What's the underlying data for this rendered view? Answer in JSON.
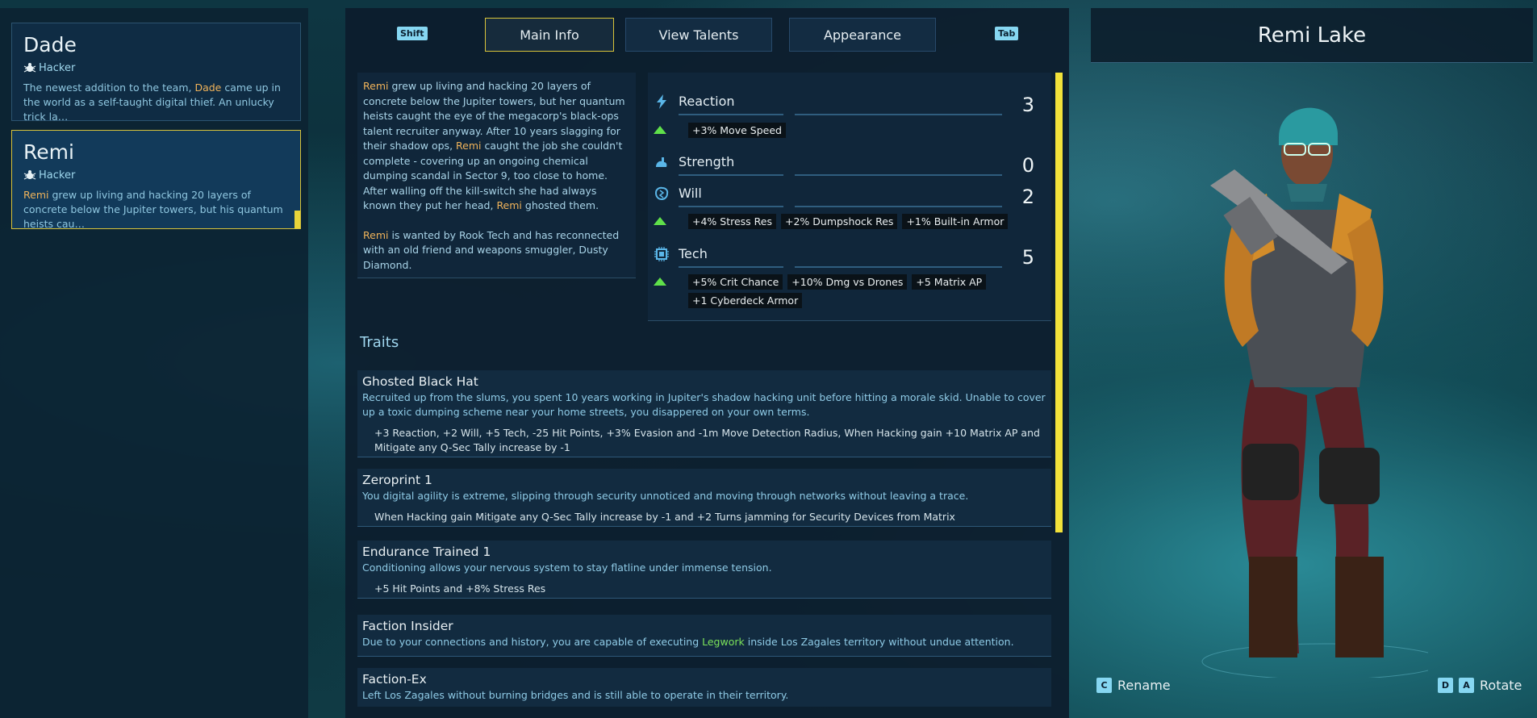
{
  "tabs": {
    "left_key": "Shift",
    "right_key": "Tab",
    "items": [
      "Main Info",
      "View Talents",
      "Appearance"
    ],
    "active": "Main Info"
  },
  "roster": [
    {
      "name": "Dade",
      "class": "Hacker",
      "desc_pre": "The newest addition to the team, ",
      "desc_hl": "Dade",
      "desc_post": " came up in the world as a self-taught digital thief. An unlucky trick la…"
    },
    {
      "name": "Remi",
      "class": "Hacker",
      "desc_hl": "Remi",
      "desc_post": " grew up living and hacking 20 layers of concrete below the Jupiter towers, but his quantum heists cau…"
    }
  ],
  "bio": {
    "p1_a": "Remi",
    "p1_b": " grew up living and hacking 20 layers of concrete below the Jupiter towers, but her quantum heists caught the eye of the megacorp's black-ops talent recruiter anyway. After 10 years slagging for their shadow ops, ",
    "p1_c": "Remi",
    "p1_d": " caught the job she couldn't complete - covering up an ongoing chemical dumping scandal in Sector 9, too close to home. After walling off the kill-switch she had always known they put her head, ",
    "p1_e": "Remi",
    "p1_f": " ghosted them.",
    "p2_a": "Remi",
    "p2_b": " is wanted by Rook Tech and has reconnected with an old friend and weapons smuggler, Dusty Diamond."
  },
  "stats": [
    {
      "name": "Reaction",
      "value": "3",
      "icon": "lightning-icon",
      "bonuses": [
        "+3% Move Speed"
      ]
    },
    {
      "name": "Strength",
      "value": "0",
      "icon": "arm-icon",
      "bonuses": []
    },
    {
      "name": "Will",
      "value": "2",
      "icon": "brain-icon",
      "bonuses": [
        "+4% Stress Res",
        "+2% Dumpshock Res",
        "+1% Built-in Armor"
      ]
    },
    {
      "name": "Tech",
      "value": "5",
      "icon": "chip-icon",
      "bonuses": [
        "+5% Crit Chance",
        "+10% Dmg vs Drones",
        "+5 Matrix AP",
        "+1 Cyberdeck Armor"
      ]
    }
  ],
  "traits_title": "Traits",
  "traits": [
    {
      "name": "Ghosted Black Hat",
      "desc": "Recruited up from the slums, you spent 10 years working in Jupiter's shadow hacking unit before hitting a morale skid. Unable to cover up a toxic dumping scheme near your home streets, you disappered on your own terms.",
      "effect": "+3 Reaction, +2 Will, +5 Tech, -25 Hit Points, +3% Evasion and -1m Move Detection Radius, When Hacking gain +10 Matrix AP and Mitigate any Q-Sec Tally increase by -1"
    },
    {
      "name": "Zeroprint 1",
      "desc": "You digital agility is extreme, slipping through security unnoticed and moving through networks without leaving a trace.",
      "effect": "When Hacking gain Mitigate any Q-Sec Tally increase by -1 and +2 Turns jamming for Security Devices from Matrix"
    },
    {
      "name": "Endurance Trained 1",
      "desc": "Conditioning allows your nervous system to stay flatline under immense tension.",
      "effect": "+5 Hit Points and +8% Stress Res"
    },
    {
      "name": "Faction Insider",
      "desc_a": "Due to your connections and history, you are capable of executing ",
      "desc_hl": "Legwork",
      "desc_b": " inside Los Zagales territory without undue attention."
    },
    {
      "name": "Faction-Ex",
      "desc": "Left Los Zagales without burning bridges and is still able to operate in their territory."
    }
  ],
  "character": {
    "name": "Remi Lake",
    "rename_key": "C",
    "rename_label": "Rename",
    "rotate_key_1": "D",
    "rotate_key_2": "A",
    "rotate_label": "Rotate"
  },
  "colors": {
    "accent_yellow": "#e8d43a",
    "highlight_orange": "#f0b35a",
    "keyword_green": "#7be25a",
    "bonus_arrow": "#5fe04a"
  }
}
